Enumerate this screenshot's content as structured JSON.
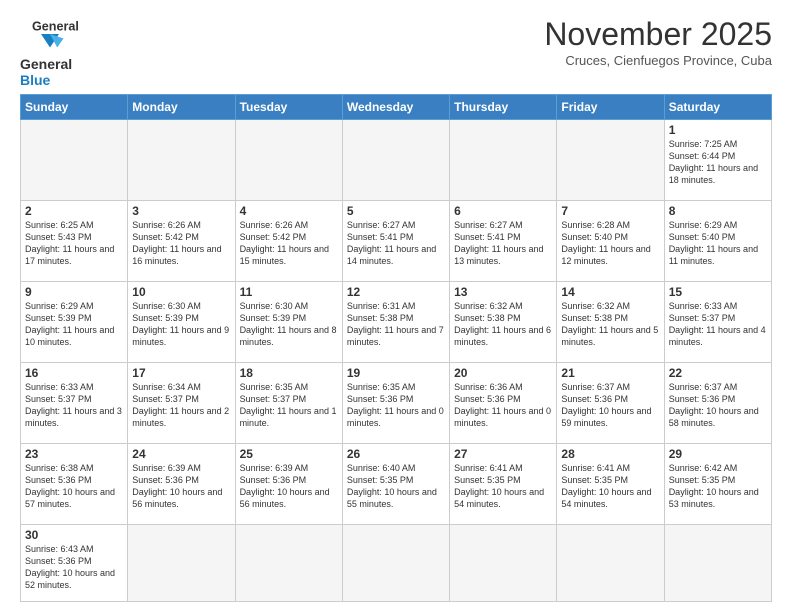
{
  "header": {
    "logo_general": "General",
    "logo_blue": "Blue",
    "month_title": "November 2025",
    "subtitle": "Cruces, Cienfuegos Province, Cuba"
  },
  "days_of_week": [
    "Sunday",
    "Monday",
    "Tuesday",
    "Wednesday",
    "Thursday",
    "Friday",
    "Saturday"
  ],
  "weeks": [
    [
      {
        "day": "",
        "info": ""
      },
      {
        "day": "",
        "info": ""
      },
      {
        "day": "",
        "info": ""
      },
      {
        "day": "",
        "info": ""
      },
      {
        "day": "",
        "info": ""
      },
      {
        "day": "",
        "info": ""
      },
      {
        "day": "1",
        "info": "Sunrise: 7:25 AM\nSunset: 6:44 PM\nDaylight: 11 hours and 18 minutes."
      }
    ],
    [
      {
        "day": "2",
        "info": "Sunrise: 6:25 AM\nSunset: 5:43 PM\nDaylight: 11 hours and 17 minutes."
      },
      {
        "day": "3",
        "info": "Sunrise: 6:26 AM\nSunset: 5:42 PM\nDaylight: 11 hours and 16 minutes."
      },
      {
        "day": "4",
        "info": "Sunrise: 6:26 AM\nSunset: 5:42 PM\nDaylight: 11 hours and 15 minutes."
      },
      {
        "day": "5",
        "info": "Sunrise: 6:27 AM\nSunset: 5:41 PM\nDaylight: 11 hours and 14 minutes."
      },
      {
        "day": "6",
        "info": "Sunrise: 6:27 AM\nSunset: 5:41 PM\nDaylight: 11 hours and 13 minutes."
      },
      {
        "day": "7",
        "info": "Sunrise: 6:28 AM\nSunset: 5:40 PM\nDaylight: 11 hours and 12 minutes."
      },
      {
        "day": "8",
        "info": "Sunrise: 6:29 AM\nSunset: 5:40 PM\nDaylight: 11 hours and 11 minutes."
      }
    ],
    [
      {
        "day": "9",
        "info": "Sunrise: 6:29 AM\nSunset: 5:39 PM\nDaylight: 11 hours and 10 minutes."
      },
      {
        "day": "10",
        "info": "Sunrise: 6:30 AM\nSunset: 5:39 PM\nDaylight: 11 hours and 9 minutes."
      },
      {
        "day": "11",
        "info": "Sunrise: 6:30 AM\nSunset: 5:39 PM\nDaylight: 11 hours and 8 minutes."
      },
      {
        "day": "12",
        "info": "Sunrise: 6:31 AM\nSunset: 5:38 PM\nDaylight: 11 hours and 7 minutes."
      },
      {
        "day": "13",
        "info": "Sunrise: 6:32 AM\nSunset: 5:38 PM\nDaylight: 11 hours and 6 minutes."
      },
      {
        "day": "14",
        "info": "Sunrise: 6:32 AM\nSunset: 5:38 PM\nDaylight: 11 hours and 5 minutes."
      },
      {
        "day": "15",
        "info": "Sunrise: 6:33 AM\nSunset: 5:37 PM\nDaylight: 11 hours and 4 minutes."
      }
    ],
    [
      {
        "day": "16",
        "info": "Sunrise: 6:33 AM\nSunset: 5:37 PM\nDaylight: 11 hours and 3 minutes."
      },
      {
        "day": "17",
        "info": "Sunrise: 6:34 AM\nSunset: 5:37 PM\nDaylight: 11 hours and 2 minutes."
      },
      {
        "day": "18",
        "info": "Sunrise: 6:35 AM\nSunset: 5:37 PM\nDaylight: 11 hours and 1 minute."
      },
      {
        "day": "19",
        "info": "Sunrise: 6:35 AM\nSunset: 5:36 PM\nDaylight: 11 hours and 0 minutes."
      },
      {
        "day": "20",
        "info": "Sunrise: 6:36 AM\nSunset: 5:36 PM\nDaylight: 11 hours and 0 minutes."
      },
      {
        "day": "21",
        "info": "Sunrise: 6:37 AM\nSunset: 5:36 PM\nDaylight: 10 hours and 59 minutes."
      },
      {
        "day": "22",
        "info": "Sunrise: 6:37 AM\nSunset: 5:36 PM\nDaylight: 10 hours and 58 minutes."
      }
    ],
    [
      {
        "day": "23",
        "info": "Sunrise: 6:38 AM\nSunset: 5:36 PM\nDaylight: 10 hours and 57 minutes."
      },
      {
        "day": "24",
        "info": "Sunrise: 6:39 AM\nSunset: 5:36 PM\nDaylight: 10 hours and 56 minutes."
      },
      {
        "day": "25",
        "info": "Sunrise: 6:39 AM\nSunset: 5:36 PM\nDaylight: 10 hours and 56 minutes."
      },
      {
        "day": "26",
        "info": "Sunrise: 6:40 AM\nSunset: 5:35 PM\nDaylight: 10 hours and 55 minutes."
      },
      {
        "day": "27",
        "info": "Sunrise: 6:41 AM\nSunset: 5:35 PM\nDaylight: 10 hours and 54 minutes."
      },
      {
        "day": "28",
        "info": "Sunrise: 6:41 AM\nSunset: 5:35 PM\nDaylight: 10 hours and 54 minutes."
      },
      {
        "day": "29",
        "info": "Sunrise: 6:42 AM\nSunset: 5:35 PM\nDaylight: 10 hours and 53 minutes."
      }
    ],
    [
      {
        "day": "30",
        "info": "Sunrise: 6:43 AM\nSunset: 5:36 PM\nDaylight: 10 hours and 52 minutes."
      },
      {
        "day": "",
        "info": ""
      },
      {
        "day": "",
        "info": ""
      },
      {
        "day": "",
        "info": ""
      },
      {
        "day": "",
        "info": ""
      },
      {
        "day": "",
        "info": ""
      },
      {
        "day": "",
        "info": ""
      }
    ]
  ]
}
